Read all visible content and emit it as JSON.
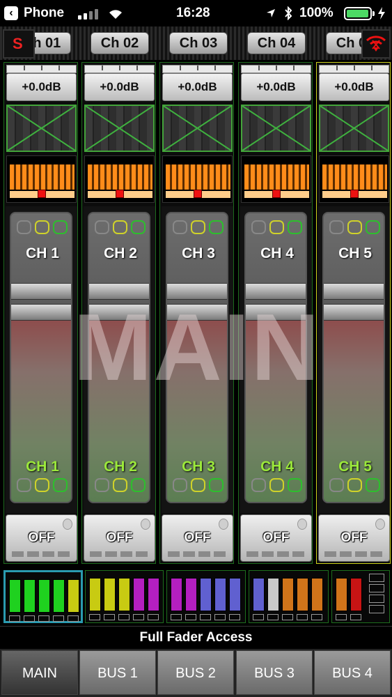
{
  "status_bar": {
    "back_app": "Phone",
    "time": "16:28",
    "battery": "100%"
  },
  "header": {
    "solo_label": "S",
    "channel_tabs": [
      "Ch 01",
      "Ch 02",
      "Ch 03",
      "Ch 04",
      "Ch 05"
    ]
  },
  "strips": [
    {
      "gain": "+0.0dB",
      "name_top": "CH 1",
      "name_bottom": "CH 1",
      "mute": "OFF"
    },
    {
      "gain": "+0.0dB",
      "name_top": "CH 2",
      "name_bottom": "CH 2",
      "mute": "OFF"
    },
    {
      "gain": "+0.0dB",
      "name_top": "CH 3",
      "name_bottom": "CH 3",
      "mute": "OFF"
    },
    {
      "gain": "+0.0dB",
      "name_top": "CH 4",
      "name_bottom": "CH 4",
      "mute": "OFF"
    },
    {
      "gain": "+0.0dB",
      "name_top": "CH 5",
      "name_bottom": "CH 5",
      "mute": "OFF"
    }
  ],
  "watermark": "MAIN",
  "banks": [
    {
      "colors": [
        "#1fd11f",
        "#1fd11f",
        "#1fd11f",
        "#1fd11f",
        "#c8cb12"
      ]
    },
    {
      "colors": [
        "#c8cb12",
        "#c8cb12",
        "#c8cb12",
        "#b41fc0",
        "#b41fc0"
      ]
    },
    {
      "colors": [
        "#b41fc0",
        "#b41fc0",
        "#6060d0",
        "#6060d0",
        "#6060d0"
      ]
    },
    {
      "colors": [
        "#6060d0",
        "#c8c8c8",
        "#d0741a",
        "#d0741a",
        "#d0741a"
      ]
    },
    {
      "colors": [
        "#d0741a",
        "#c81414"
      ]
    }
  ],
  "full_fader_access": "Full Fader Access",
  "bottom_tabs": [
    "MAIN",
    "BUS 1",
    "BUS 2",
    "BUS 3",
    "BUS 4"
  ],
  "colors": {
    "strip_border": "#1d6b1d",
    "selected_strip_border": "#cdd31a",
    "pan_bars": "#ff8c1a",
    "bottom_label_green": "#9be83b"
  }
}
